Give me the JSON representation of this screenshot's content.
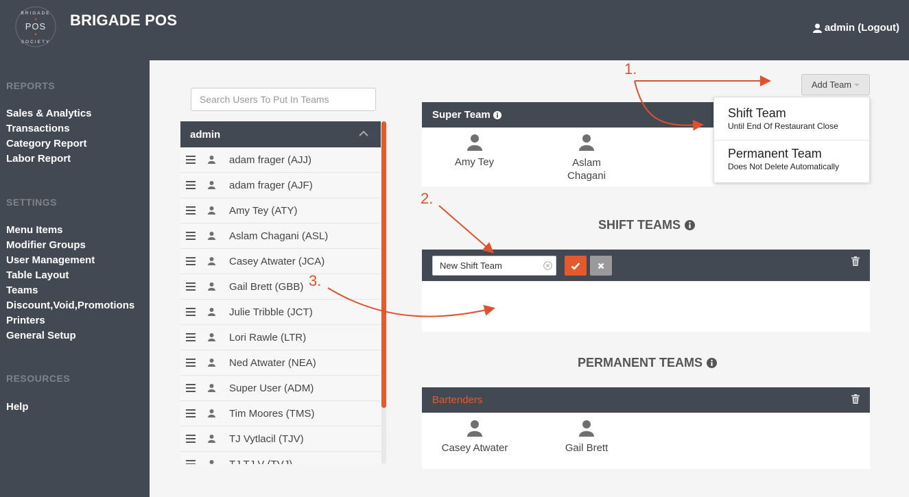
{
  "app": {
    "logo": {
      "top_text": "BRIGADE",
      "center_text": "POS",
      "bottom_text": "SOCIETY"
    },
    "brand": "BRIGADE POS",
    "user_label": "admin (Logout)"
  },
  "sidebar": {
    "sections": [
      {
        "heading": "REPORTS",
        "items": [
          "Sales & Analytics",
          "Transactions",
          "Category Report",
          "Labor Report"
        ]
      },
      {
        "heading": "SETTINGS",
        "items": [
          "Menu Items",
          "Modifier Groups",
          "User Management",
          "Table Layout",
          "Teams",
          "Discount,Void,Promotions",
          "Printers",
          "General Setup"
        ]
      },
      {
        "heading": "RESOURCES",
        "items": [
          "Help"
        ]
      }
    ]
  },
  "search": {
    "placeholder": "Search Users To Put In Teams"
  },
  "user_list": {
    "header": "admin",
    "users": [
      "adam frager (AJJ)",
      "adam frager (AJF)",
      "Amy Tey (ATY)",
      "Aslam Chagani (ASL)",
      "Casey Atwater (JCA)",
      "Gail Brett (GBB)",
      "Julie Tribble (JCT)",
      "Lori Rawle (LTR)",
      "Ned Atwater (NEA)",
      "Super User (ADM)",
      "Tim Moores (TMS)",
      "TJ Vytlacil (TJV)",
      "TJ TJ V (TVJ)"
    ]
  },
  "add_team": {
    "label": "Add Team",
    "options": [
      {
        "title": "Shift Team",
        "subtitle": "Until End Of Restaurant Close"
      },
      {
        "title": "Permanent Team",
        "subtitle": "Does Not Delete Automatically"
      }
    ]
  },
  "super_team": {
    "title": "Super Team",
    "members": [
      "Amy Tey",
      "Aslam Chagani"
    ]
  },
  "shift_teams": {
    "title": "SHIFT TEAMS",
    "new_team_value": "New Shift Team"
  },
  "permanent_teams": {
    "title": "PERMANENT TEAMS",
    "teams": [
      {
        "name": "Bartenders",
        "members": [
          "Casey Atwater",
          "Gail Brett"
        ]
      }
    ]
  },
  "annotations": [
    "1.",
    "2.",
    "3."
  ],
  "colors": {
    "accent": "#e35a2d",
    "dark": "#434952",
    "panel_bg": "#f5f5f5"
  }
}
